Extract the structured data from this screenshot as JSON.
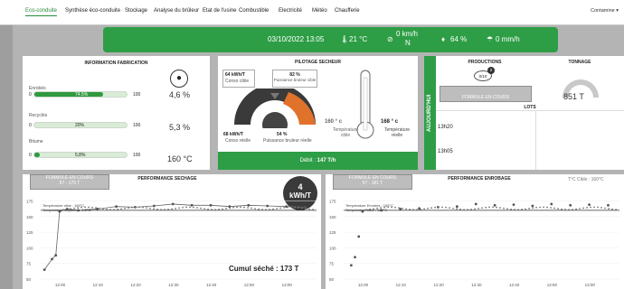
{
  "nav": {
    "items": [
      "Eco-conduite",
      "Synthèse éco-conduite",
      "Stockage",
      "Analyse du brûleur",
      "Etat de l'usine",
      "Combustible",
      "Electricité",
      "Météo",
      "Chaufferie"
    ],
    "dropdown": "Contamine ▾"
  },
  "weather": {
    "datetime": "03/10/2022 13:05",
    "temperature": "21 °C",
    "wind": "0 km/h",
    "wind_dir": "N",
    "humidity": "64 %",
    "rain": "0 mm/h",
    "icons": [
      "thermometer-icon",
      "wind-icon",
      "droplet-icon",
      "rain-icon"
    ]
  },
  "fabrication": {
    "title": "INFORMATION FABRICATION",
    "rows": [
      {
        "label": "Enrobés",
        "min": "0",
        "pct_label": "74.5%",
        "max": "100",
        "value": "4,6 %",
        "fill": 0.745
      },
      {
        "label": "Recyclés",
        "min": "0",
        "pct_label": "20%",
        "max": "100",
        "value": "5,3 %",
        "fill": 0.0
      },
      {
        "label": "Bitume",
        "min": "0",
        "pct_label": "5,8%",
        "max": "100",
        "value": "160 °C",
        "fill": 0.058
      }
    ]
  },
  "pilotage": {
    "title": "PILOTAGE SECHEUR",
    "conso_cible_val": "64 kWh/T",
    "conso_cible_lbl": "Conso cible",
    "puiss_cible_val": "82 %",
    "puiss_cible_lbl": "Puissance bruleur cible",
    "conso_reelle_val": "68 kWh/T",
    "conso_reelle_lbl": "Conso réelle",
    "puiss_reelle_val": "54 %",
    "puiss_reelle_lbl": "Puissance bruleur réelle",
    "temp_cible_val": "160 ° c",
    "temp_cible_lbl": "Température cible",
    "temp_reelle_val": "168 ° c",
    "temp_reelle_lbl": "Température réelle",
    "debit_label": "Débit :",
    "debit_value": "147 T/h"
  },
  "aujourdhui": "AUJOURD'HUI",
  "productions": {
    "title": "PRODUCTIONS",
    "badge": "2",
    "product": "0/10",
    "formule": "FORMULE EN COURS"
  },
  "tonnage": {
    "title": "TONNAGE",
    "value": "851 T"
  },
  "lots": {
    "title": "LOTS",
    "times": [
      "13h20",
      "13h05"
    ]
  },
  "sechage": {
    "formule": "FORMULE EN COURS",
    "range": "57 - 175 T",
    "title": "PERFORMANCE SECHAGE",
    "kwh_value": "4",
    "kwh_unit": "kWh/T",
    "legend1": "Température cible : 160°C",
    "legend2": "Température moyenne : 5.5°C",
    "cumul": "Cumul séché : 173 T",
    "y_ticks": [
      "175",
      "150",
      "125",
      "100",
      "75",
      "50"
    ],
    "x_ticks": [
      "12:00",
      "12:10",
      "12:20",
      "12:30",
      "12:40",
      "12:50",
      "13:00"
    ]
  },
  "enrobage": {
    "formule": "FORMULE EN COURS",
    "range": "57 - 181 T",
    "title": "PERFORMANCE ENROBAGE",
    "target": "T°C Cible : 160°C",
    "legend1": "Température Enrobés : 165°C",
    "legend2": "Température cible : 160°C",
    "y_ticks": [
      "175",
      "150",
      "125",
      "100",
      "75",
      "50"
    ],
    "x_ticks": [
      "12:00",
      "12:10",
      "12:20",
      "12:30",
      "12:40",
      "12:50",
      "13:00"
    ]
  },
  "chart_data": [
    {
      "type": "line",
      "title": "PERFORMANCE SECHAGE",
      "xlabel": "",
      "ylabel": "",
      "x": [
        "11:56",
        "11:58",
        "11:59",
        "12:00",
        "12:02",
        "12:05",
        "12:10",
        "12:15",
        "12:20",
        "12:25",
        "12:30",
        "12:35",
        "12:40",
        "12:45",
        "12:50",
        "12:55",
        "13:00",
        "13:05"
      ],
      "series": [
        {
          "values": [
            65,
            82,
            88,
            158,
            162,
            160,
            162,
            166,
            165,
            167,
            170,
            168,
            168,
            166,
            168,
            167,
            166,
            165
          ]
        }
      ],
      "target": 160,
      "ylim": [
        50,
        180
      ]
    },
    {
      "type": "scatter",
      "title": "PERFORMANCE ENROBAGE",
      "xlabel": "",
      "ylabel": "",
      "x": [
        "11:57",
        "11:58",
        "11:59",
        "12:00",
        "12:05",
        "12:10",
        "12:15",
        "12:20",
        "12:25",
        "12:30",
        "12:35",
        "12:40",
        "12:45",
        "12:50",
        "12:55",
        "13:00",
        "13:05"
      ],
      "series": [
        {
          "values": [
            72,
            85,
            118,
            158,
            160,
            162,
            163,
            165,
            166,
            170,
            168,
            169,
            167,
            170,
            168,
            169,
            168
          ]
        }
      ],
      "target": 160,
      "ylim": [
        50,
        180
      ]
    }
  ]
}
